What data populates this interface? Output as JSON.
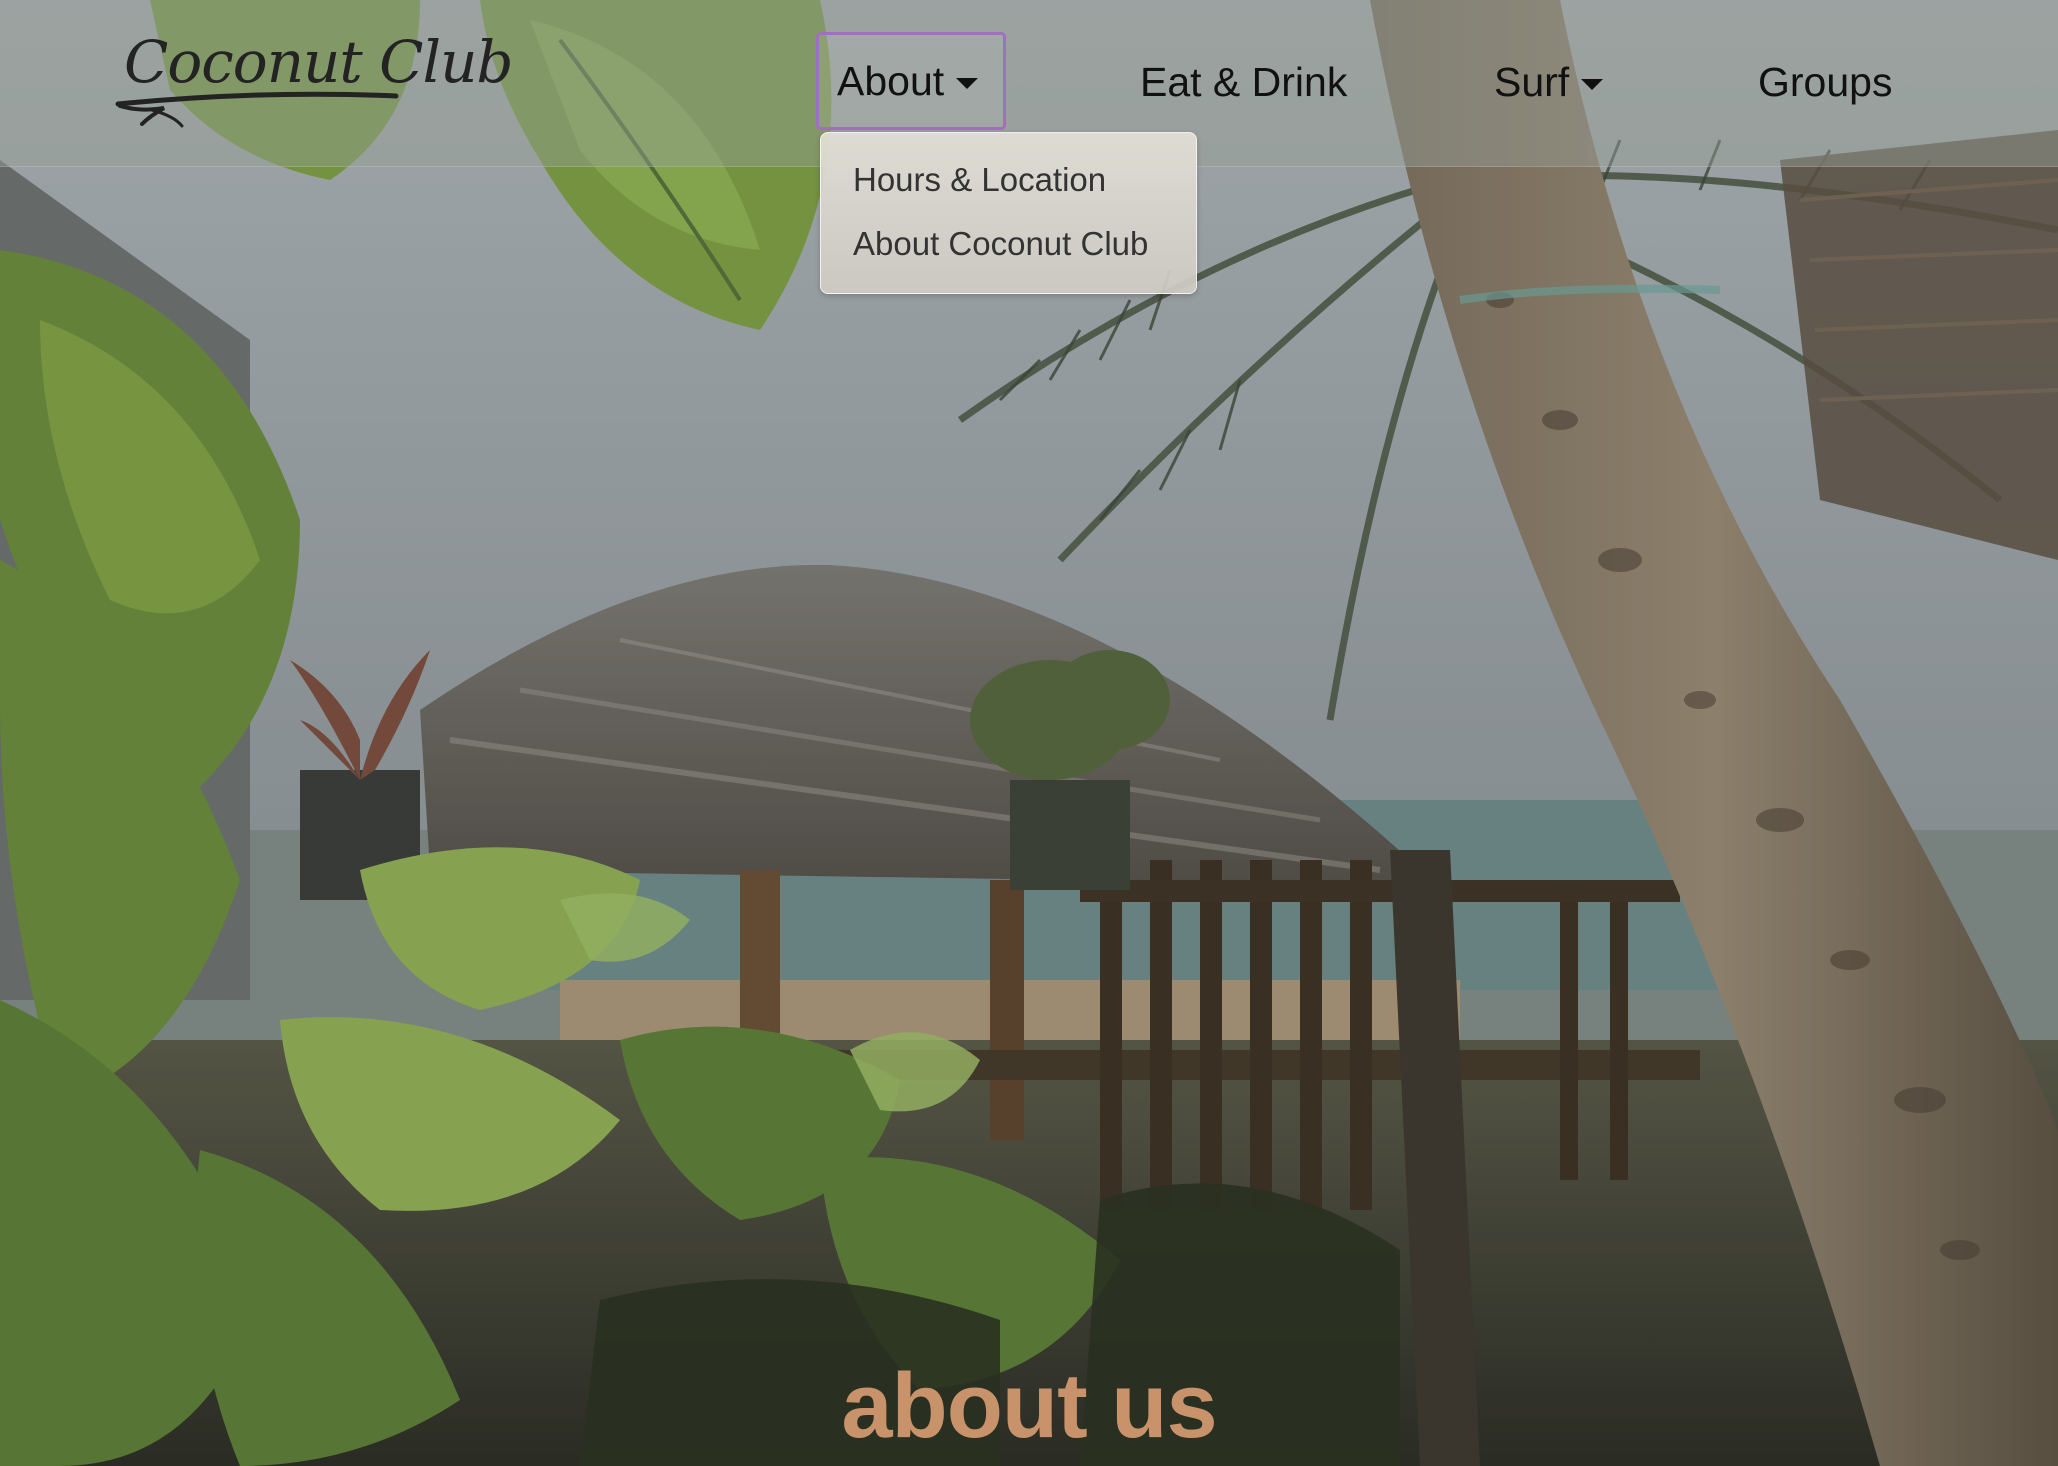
{
  "brand": {
    "logo_text": "Coconut Club"
  },
  "nav": {
    "items": [
      {
        "label": "About",
        "has_dropdown": true,
        "active": true
      },
      {
        "label": "Eat & Drink",
        "has_dropdown": false
      },
      {
        "label": "Surf",
        "has_dropdown": true
      },
      {
        "label": "Groups",
        "has_dropdown": false
      }
    ],
    "about_dropdown": {
      "items": [
        {
          "label": "Hours & Location"
        },
        {
          "label": "About Coconut Club"
        }
      ]
    }
  },
  "hero": {
    "heading": "about us",
    "image_description_icon": "hero-photo"
  },
  "colors": {
    "heading": "#c8926a",
    "focus_outline": "#a06fc0",
    "nav_text": "#111111"
  }
}
